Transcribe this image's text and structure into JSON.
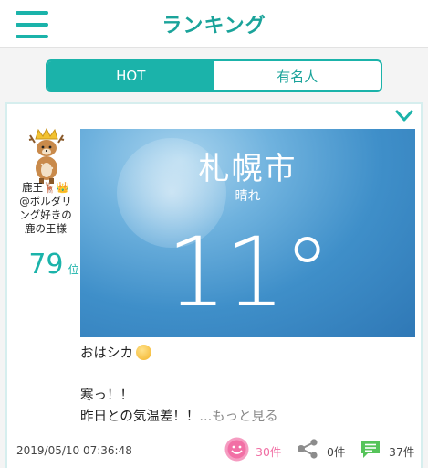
{
  "header": {
    "title": "ランキング"
  },
  "tabs": [
    {
      "label": "HOT",
      "active": true
    },
    {
      "label": "有名人",
      "active": false
    }
  ],
  "post": {
    "username_lines": [
      "鹿王🦌👑",
      "@ボルダリ",
      "ング好きの",
      "鹿の王様"
    ],
    "rank_number": "79",
    "rank_unit": "位",
    "weather": {
      "city": "札幌市",
      "condition": "晴れ",
      "temperature": "11°"
    },
    "text_line1": "おはシカ",
    "text_line3": "寒っ！！",
    "text_line4": "昨日との気温差！！",
    "more_label": "...もっと見る",
    "timestamp": "2019/05/10 07:36:48",
    "likes": "30件",
    "shares": "0件",
    "comments": "37件"
  },
  "colors": {
    "accent": "#1bb3aa",
    "like": "#f26fa5",
    "comment": "#56c45a"
  },
  "icons": [
    "menu-icon",
    "chevron-down-icon",
    "sun-emoji-icon",
    "smile-like-icon",
    "share-icon",
    "comment-icon"
  ]
}
